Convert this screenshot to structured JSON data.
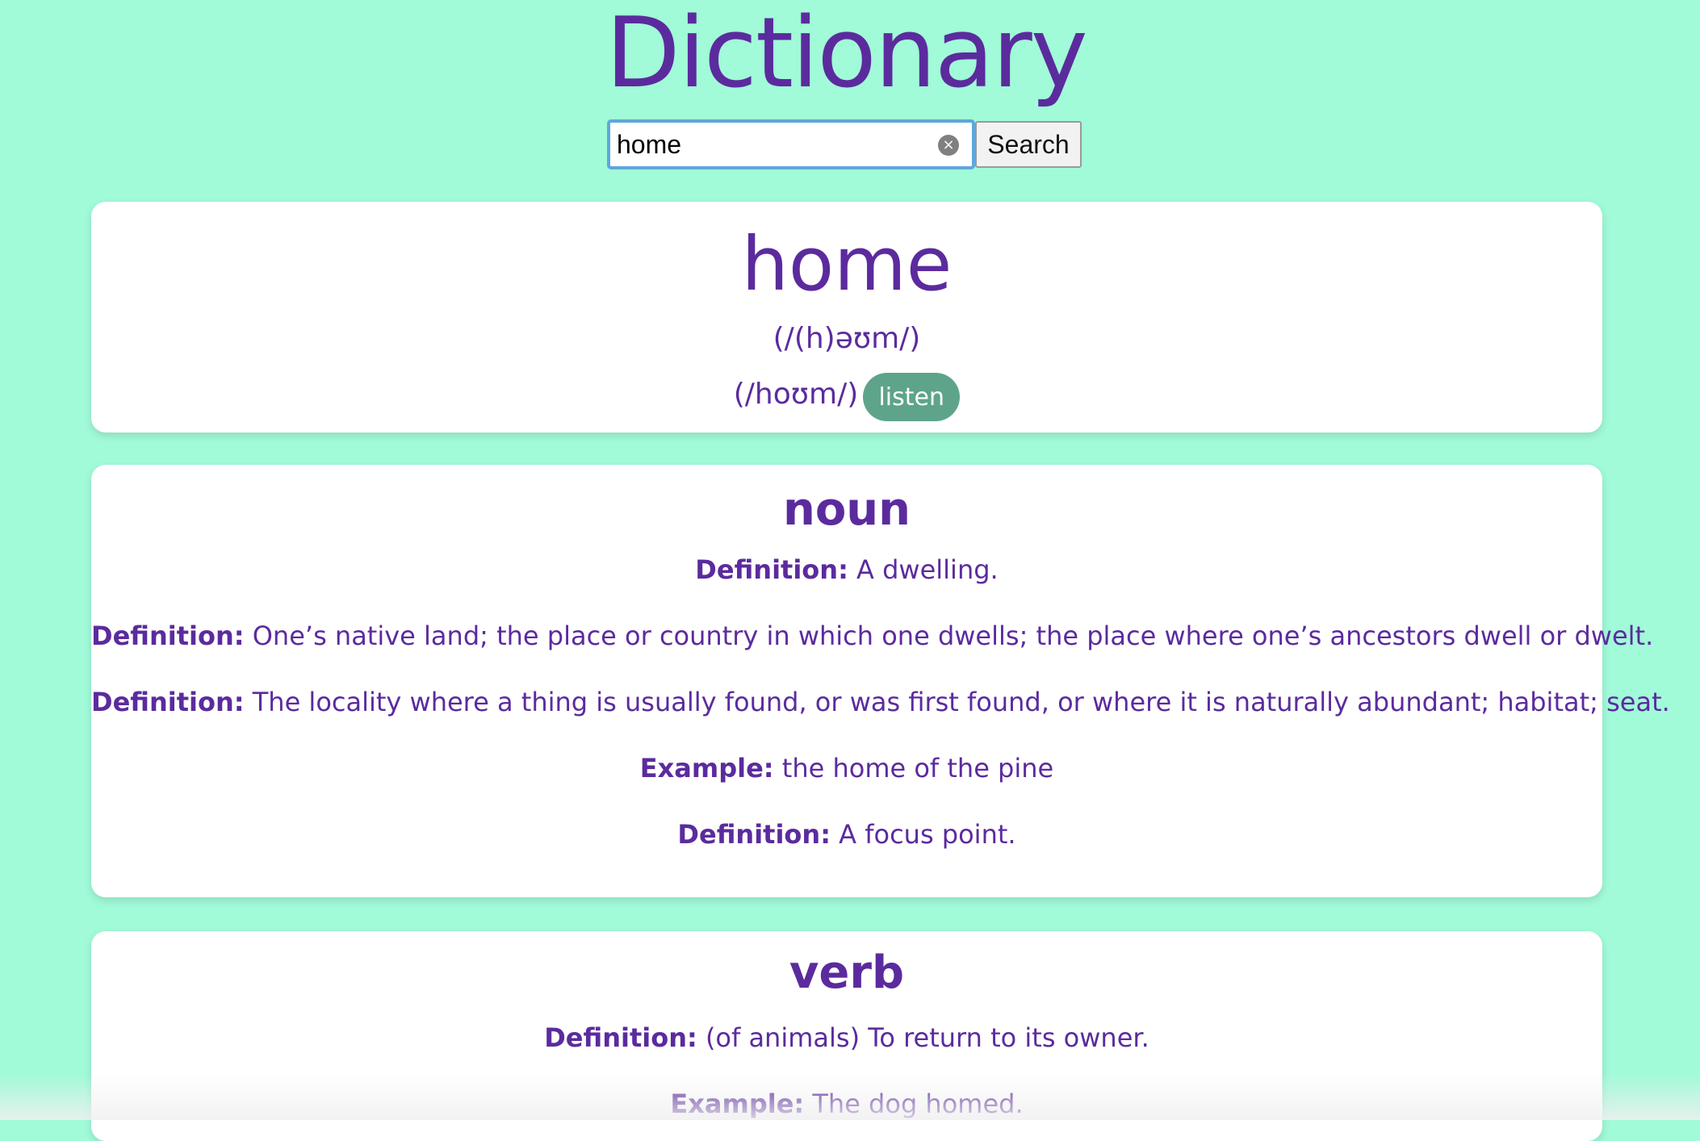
{
  "app": {
    "title": "Dictionary"
  },
  "search": {
    "value": "home",
    "button_label": "Search",
    "clear_glyph": "×"
  },
  "entry": {
    "word": "home",
    "phonetics": [
      "(/(h)əʊm/)",
      "(/hoʊm/)"
    ],
    "listen_label": "listen"
  },
  "meanings": [
    {
      "part_of_speech": "noun",
      "lines": [
        {
          "label": "Definition:",
          "text": "A dwelling."
        },
        {
          "label": "Definition:",
          "text": "One’s native land; the place or country in which one dwells; the place where one’s ancestors dwell or dwelt."
        },
        {
          "label": "Definition:",
          "text": "The locality where a thing is usually found, or was first found, or where it is naturally abundant; habitat; seat."
        },
        {
          "label": "Example:",
          "text": "the home of the pine"
        },
        {
          "label": "Definition:",
          "text": "A focus point."
        }
      ]
    },
    {
      "part_of_speech": "verb",
      "lines": [
        {
          "label": "Definition:",
          "text": "(of animals) To return to its owner."
        },
        {
          "label": "Example:",
          "text": "The dog homed."
        }
      ]
    }
  ],
  "colors": {
    "background": "#a1fad8",
    "text_accent": "#5b2b9e",
    "listen_button": "#5ea48a",
    "search_focus_border": "#5ea7dc"
  }
}
